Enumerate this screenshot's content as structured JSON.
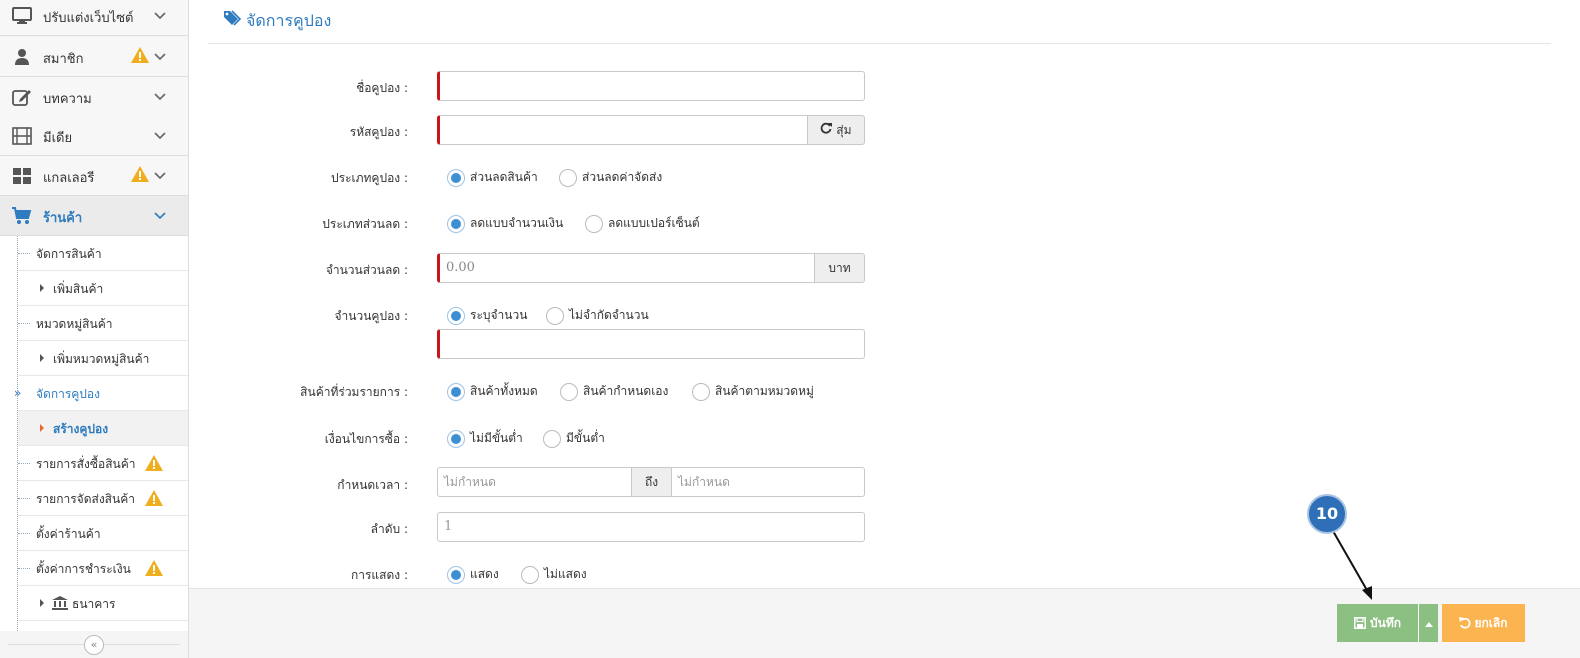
{
  "sidebar": {
    "menu": [
      {
        "label": "ปรับแต่งเว็บไซต์",
        "icon": "monitor-icon",
        "warning": false
      },
      {
        "label": "สมาชิก",
        "icon": "user-icon",
        "warning": true
      },
      {
        "label": "บทความ",
        "icon": "edit-icon",
        "warning": false
      },
      {
        "label": "มีเดีย",
        "icon": "film-icon",
        "warning": false
      },
      {
        "label": "แกลเลอรี",
        "icon": "grid-icon",
        "warning": true
      },
      {
        "label": "ร้านค้า",
        "icon": "cart-icon",
        "warning": false,
        "active": true
      }
    ],
    "shop_submenu": [
      {
        "label": "จัดการสินค้า"
      },
      {
        "label": "เพิ่มสินค้า"
      },
      {
        "label": "หมวดหมู่สินค้า"
      },
      {
        "label": "เพิ่มหมวดหมู่สินค้า"
      },
      {
        "label": "จัดการคูปอง"
      },
      {
        "label": "สร้างคูปอง"
      },
      {
        "label": "รายการสั่งซื้อสินค้า"
      },
      {
        "label": "รายการจัดส่งสินค้า"
      },
      {
        "label": "ตั้งค่าร้านค้า"
      },
      {
        "label": "ตั้งค่าการชำระเงิน"
      },
      {
        "label": "ธนาคาร"
      }
    ],
    "collapse_icon": "double-chevron-left-icon"
  },
  "header": {
    "title": "จัดการคูปอง",
    "icon": "tags-icon"
  },
  "form": {
    "coupon_name": {
      "label": "ชื่อคูปอง :",
      "value": ""
    },
    "coupon_code": {
      "label": "รหัสคูปอง :",
      "value": "",
      "random_label": "สุ่ม"
    },
    "coupon_type": {
      "label": "ประเภทคูปอง :",
      "options": [
        "ส่วนลดสินค้า",
        "ส่วนลดค่าจัดส่ง"
      ],
      "selected": "ส่วนลดสินค้า"
    },
    "discount_type": {
      "label": "ประเภทส่วนลด :",
      "options": [
        "ลดแบบจำนวนเงิน",
        "ลดแบบเปอร์เซ็นต์"
      ],
      "selected": "ลดแบบจำนวนเงิน"
    },
    "discount_amount": {
      "label": "จำนวนส่วนลด :",
      "placeholder": "0.00",
      "unit": "บาท"
    },
    "coupon_quantity": {
      "label": "จำนวนคูปอง :",
      "options": [
        "ระบุจำนวน",
        "ไม่จำกัดจำนวน"
      ],
      "selected": "ระบุจำนวน",
      "value": ""
    },
    "products": {
      "label": "สินค้าที่ร่วมรายการ :",
      "options": [
        "สินค้าทั้งหมด",
        "สินค้ากำหนดเอง",
        "สินค้าตามหมวดหมู่"
      ],
      "selected": "สินค้าทั้งหมด"
    },
    "purchase_condition": {
      "label": "เงื่อนไขการซื้อ :",
      "options": [
        "ไม่มีขั้นต่ำ",
        "มีขั้นต่ำ"
      ],
      "selected": "ไม่มีขั้นต่ำ"
    },
    "period": {
      "label": "กำหนดเวลา :",
      "from_placeholder": "ไม่กำหนด",
      "to_label": "ถึง",
      "to_placeholder": "ไม่กำหนด"
    },
    "order": {
      "label": "ลำดับ :",
      "placeholder": "1"
    },
    "display": {
      "label": "การแสดง :",
      "options": [
        "แสดง",
        "ไม่แสดง"
      ],
      "selected": "แสดง"
    }
  },
  "footer": {
    "save_label": "บันทึก",
    "cancel_label": "ยกเลิก"
  },
  "annotation": {
    "step": "10"
  },
  "colors": {
    "accent": "#2f7bbf",
    "required": "#c8161d",
    "save": "#8cbf82",
    "cancel": "#fbb450",
    "callout": "#2e6fb7",
    "warning": "#f0ad1d"
  }
}
